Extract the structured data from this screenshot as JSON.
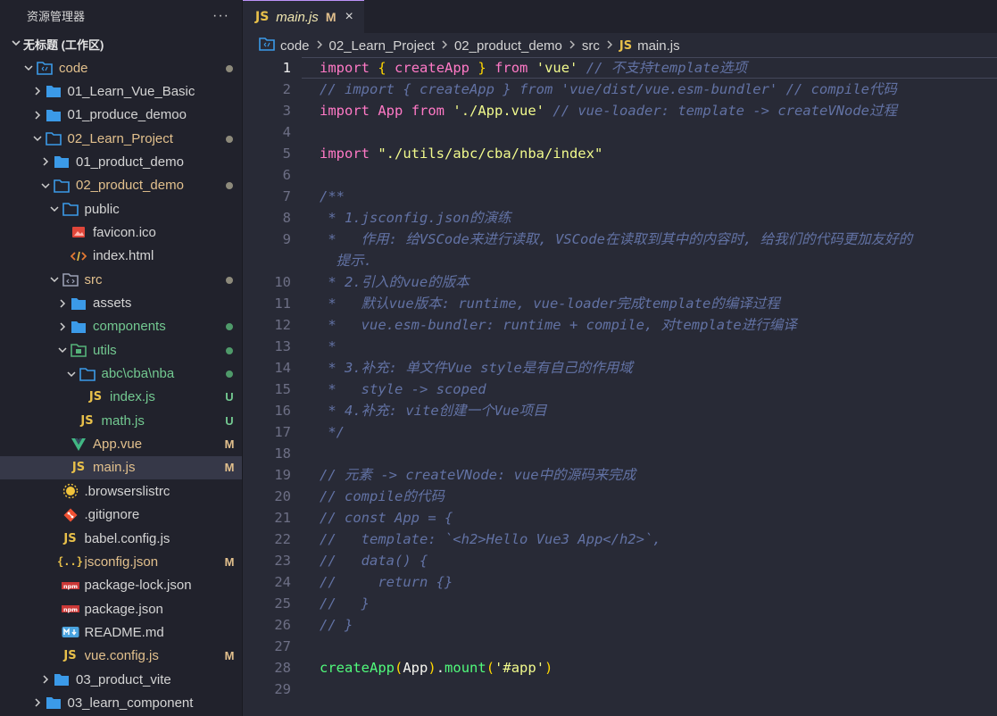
{
  "sidebar": {
    "title": "资源管理器",
    "more": "···",
    "workspace": "无标题 (工作区)",
    "tree": [
      {
        "label": "code",
        "depth": 0,
        "kind": "root",
        "chev": "down",
        "status": "dot",
        "color": "mod"
      },
      {
        "label": "01_Learn_Vue_Basic",
        "depth": 1,
        "kind": "folder",
        "chev": "right",
        "status": "",
        "color": "default"
      },
      {
        "label": "01_produce_demoo",
        "depth": 1,
        "kind": "folder",
        "chev": "right",
        "status": "",
        "color": "default"
      },
      {
        "label": "02_Learn_Project",
        "depth": 1,
        "kind": "folder-open",
        "chev": "down",
        "status": "dot",
        "color": "mod"
      },
      {
        "label": "01_product_demo",
        "depth": 2,
        "kind": "folder",
        "chev": "right",
        "status": "",
        "color": "default"
      },
      {
        "label": "02_product_demo",
        "depth": 2,
        "kind": "folder-open",
        "chev": "down",
        "status": "dot",
        "color": "mod"
      },
      {
        "label": "public",
        "depth": 3,
        "kind": "folder-open",
        "chev": "down",
        "status": "",
        "color": "default"
      },
      {
        "label": "favicon.ico",
        "depth": 4,
        "kind": "image",
        "chev": "",
        "status": "",
        "color": "default"
      },
      {
        "label": "index.html",
        "depth": 4,
        "kind": "html",
        "chev": "",
        "status": "",
        "color": "default"
      },
      {
        "label": "src",
        "depth": 3,
        "kind": "src",
        "chev": "down",
        "status": "dot",
        "color": "mod"
      },
      {
        "label": "assets",
        "depth": 4,
        "kind": "folder",
        "chev": "right",
        "status": "",
        "color": "default"
      },
      {
        "label": "components",
        "depth": 4,
        "kind": "folder",
        "chev": "right",
        "status": "dot-green",
        "color": "untracked"
      },
      {
        "label": "utils",
        "depth": 4,
        "kind": "utils",
        "chev": "down",
        "status": "dot-green",
        "color": "untracked"
      },
      {
        "label": "abc\\cba\\nba",
        "depth": 5,
        "kind": "folder-open",
        "chev": "down",
        "status": "dot-green",
        "color": "untracked"
      },
      {
        "label": "index.js",
        "depth": 6,
        "kind": "js",
        "chev": "",
        "status": "U",
        "color": "untracked"
      },
      {
        "label": "math.js",
        "depth": 5,
        "kind": "js",
        "chev": "",
        "status": "U",
        "color": "untracked"
      },
      {
        "label": "App.vue",
        "depth": 4,
        "kind": "vue",
        "chev": "",
        "status": "M",
        "color": "mod"
      },
      {
        "label": "main.js",
        "depth": 4,
        "kind": "js",
        "chev": "",
        "status": "M",
        "color": "mod",
        "selected": true
      },
      {
        "label": ".browserslistrc",
        "depth": 3,
        "kind": "browsers",
        "chev": "",
        "status": "",
        "color": "default"
      },
      {
        "label": ".gitignore",
        "depth": 3,
        "kind": "git",
        "chev": "",
        "status": "",
        "color": "default"
      },
      {
        "label": "babel.config.js",
        "depth": 3,
        "kind": "js",
        "chev": "",
        "status": "",
        "color": "default"
      },
      {
        "label": "jsconfig.json",
        "depth": 3,
        "kind": "json",
        "chev": "",
        "status": "M",
        "color": "mod"
      },
      {
        "label": "package-lock.json",
        "depth": 3,
        "kind": "npm",
        "chev": "",
        "status": "",
        "color": "default"
      },
      {
        "label": "package.json",
        "depth": 3,
        "kind": "npm",
        "chev": "",
        "status": "",
        "color": "default"
      },
      {
        "label": "README.md",
        "depth": 3,
        "kind": "md",
        "chev": "",
        "status": "",
        "color": "default"
      },
      {
        "label": "vue.config.js",
        "depth": 3,
        "kind": "js",
        "chev": "",
        "status": "M",
        "color": "mod"
      },
      {
        "label": "03_product_vite",
        "depth": 2,
        "kind": "folder",
        "chev": "right",
        "status": "",
        "color": "default"
      },
      {
        "label": "03_learn_component",
        "depth": 1,
        "kind": "folder",
        "chev": "right",
        "status": "",
        "color": "default"
      }
    ]
  },
  "tab": {
    "icon": "JS",
    "name": "main.js",
    "status": "M",
    "close": "×"
  },
  "breadcrumb": [
    "code",
    "02_Learn_Project",
    "02_product_demo",
    "src",
    "main.js"
  ],
  "editor": {
    "active_line": 1,
    "lines": [
      {
        "n": "1",
        "t": [
          [
            "kw",
            "import"
          ],
          [
            "id",
            " "
          ],
          [
            "brk",
            "{"
          ],
          [
            "id",
            " "
          ],
          [
            "imp",
            "createApp"
          ],
          [
            "id",
            " "
          ],
          [
            "brk",
            "}"
          ],
          [
            "id",
            " "
          ],
          [
            "kw",
            "from"
          ],
          [
            "id",
            " "
          ],
          [
            "str",
            "'vue'"
          ],
          [
            "id",
            " "
          ],
          [
            "cm",
            "// 不支持template选项"
          ]
        ]
      },
      {
        "n": "2",
        "t": [
          [
            "cm",
            "// import { createApp } from 'vue/dist/vue.esm-bundler' // compile代码"
          ]
        ]
      },
      {
        "n": "3",
        "t": [
          [
            "kw",
            "import"
          ],
          [
            "id",
            " "
          ],
          [
            "imp",
            "App"
          ],
          [
            "id",
            " "
          ],
          [
            "kw",
            "from"
          ],
          [
            "id",
            " "
          ],
          [
            "str",
            "'./App.vue'"
          ],
          [
            "id",
            " "
          ],
          [
            "cm",
            "// vue-loader: template -> createVNode过程"
          ]
        ]
      },
      {
        "n": "4",
        "t": []
      },
      {
        "n": "5",
        "t": [
          [
            "kw",
            "import"
          ],
          [
            "id",
            " "
          ],
          [
            "str",
            "\"./utils/abc/cba/nba/index\""
          ]
        ]
      },
      {
        "n": "6",
        "t": []
      },
      {
        "n": "7",
        "t": [
          [
            "cm",
            "/**"
          ]
        ]
      },
      {
        "n": "8",
        "t": [
          [
            "cm",
            " * 1.jsconfig.json的演练"
          ]
        ]
      },
      {
        "n": "9",
        "t": [
          [
            "cm",
            " *   作用: 给VSCode来进行读取, VSCode在读取到其中的内容时, 给我们的代码更加友好的"
          ]
        ]
      },
      {
        "n": "",
        "t": [
          [
            "cm",
            "  提示."
          ]
        ]
      },
      {
        "n": "10",
        "t": [
          [
            "cm",
            " * 2.引入的vue的版本"
          ]
        ]
      },
      {
        "n": "11",
        "t": [
          [
            "cm",
            " *   默认vue版本: runtime, vue-loader完成template的编译过程"
          ]
        ]
      },
      {
        "n": "12",
        "t": [
          [
            "cm",
            " *   vue.esm-bundler: runtime + compile, 对template进行编译"
          ]
        ]
      },
      {
        "n": "13",
        "t": [
          [
            "cm",
            " *"
          ]
        ]
      },
      {
        "n": "14",
        "t": [
          [
            "cm",
            " * 3.补充: 单文件Vue style是有自己的作用域"
          ]
        ]
      },
      {
        "n": "15",
        "t": [
          [
            "cm",
            " *   style -> scoped"
          ]
        ]
      },
      {
        "n": "16",
        "t": [
          [
            "cm",
            " * 4.补充: vite创建一个Vue项目"
          ]
        ]
      },
      {
        "n": "17",
        "t": [
          [
            "cm",
            " */"
          ]
        ]
      },
      {
        "n": "18",
        "t": []
      },
      {
        "n": "19",
        "t": [
          [
            "cm",
            "// 元素 -> createVNode: vue中的源码来完成"
          ]
        ]
      },
      {
        "n": "20",
        "t": [
          [
            "cm",
            "// compile的代码"
          ]
        ]
      },
      {
        "n": "21",
        "t": [
          [
            "cm",
            "// const App = {"
          ]
        ]
      },
      {
        "n": "22",
        "t": [
          [
            "cm",
            "//   template: `<h2>Hello Vue3 App</h2>`,"
          ]
        ]
      },
      {
        "n": "23",
        "t": [
          [
            "cm",
            "//   data() {"
          ]
        ]
      },
      {
        "n": "24",
        "t": [
          [
            "cm",
            "//     return {}"
          ]
        ]
      },
      {
        "n": "25",
        "t": [
          [
            "cm",
            "//   }"
          ]
        ]
      },
      {
        "n": "26",
        "t": [
          [
            "cm",
            "// }"
          ]
        ]
      },
      {
        "n": "27",
        "t": []
      },
      {
        "n": "28",
        "t": [
          [
            "fn",
            "createApp"
          ],
          [
            "brk",
            "("
          ],
          [
            "id",
            "App"
          ],
          [
            "brk",
            ")"
          ],
          [
            "id",
            "."
          ],
          [
            "fn",
            "mount"
          ],
          [
            "brk",
            "("
          ],
          [
            "str",
            "'#app'"
          ],
          [
            "brk",
            ")"
          ]
        ]
      },
      {
        "n": "29",
        "t": []
      }
    ]
  },
  "colors": {
    "accent": "#bd93f9",
    "modified": "#e2c08d",
    "untracked": "#73c991",
    "folder": "#3b9ae8"
  }
}
